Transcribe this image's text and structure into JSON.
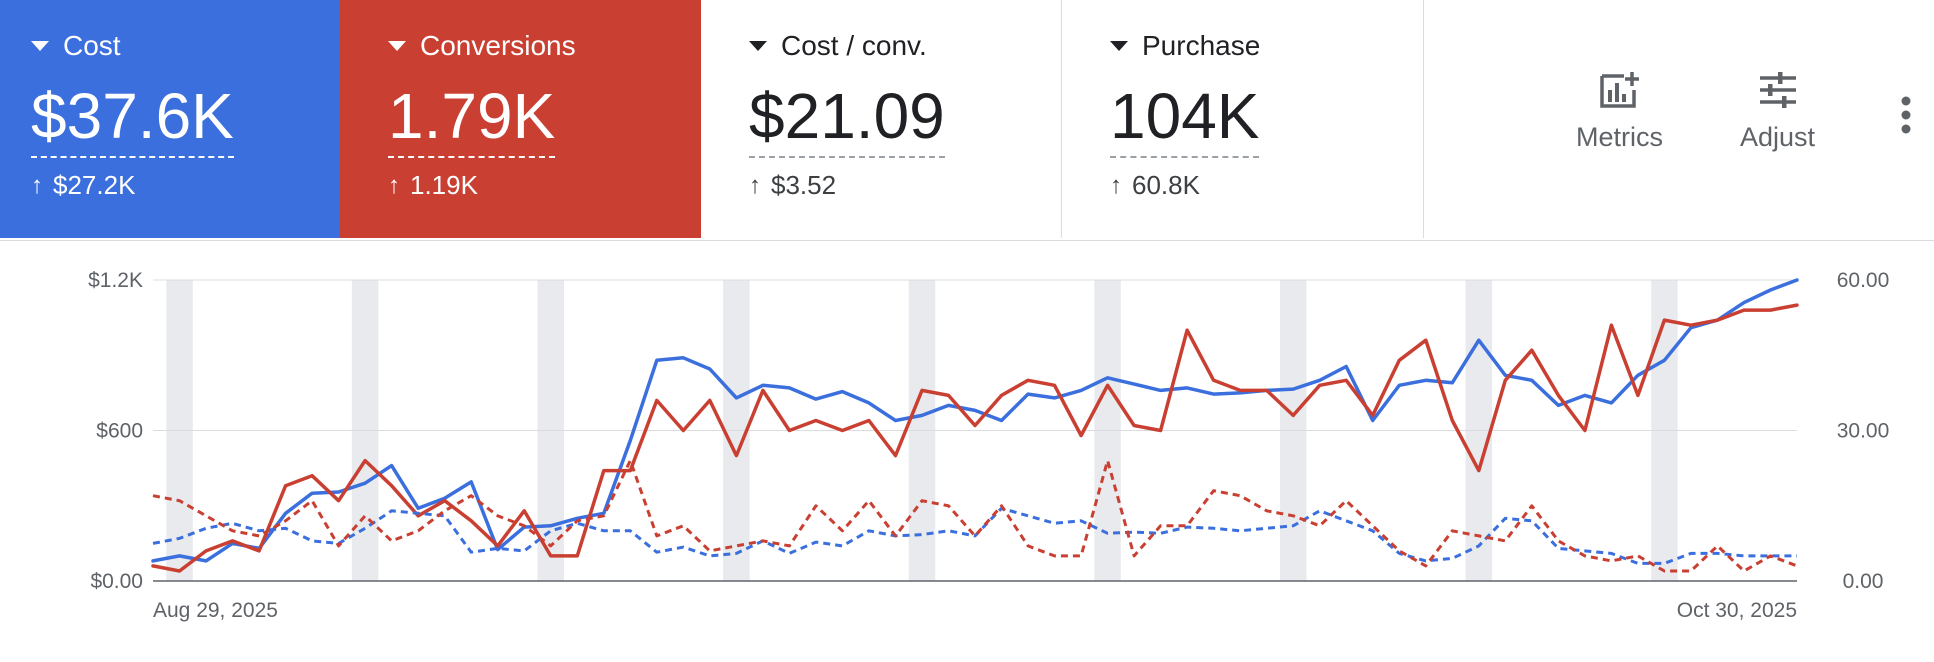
{
  "scorecards": [
    {
      "label": "Cost",
      "value": "$37.6K",
      "delta": "$27.2K",
      "bg": "#3b6fde",
      "text_color": "#ffffff"
    },
    {
      "label": "Conversions",
      "value": "1.79K",
      "delta": "1.19K",
      "bg": "#c94032",
      "text_color": "#ffffff"
    },
    {
      "label": "Cost / conv.",
      "value": "$21.09",
      "delta": "$3.52",
      "bg": "#ffffff",
      "text_color": "#202124"
    },
    {
      "label": "Purchase",
      "value": "104K",
      "delta": "60.8K",
      "bg": "#ffffff",
      "text_color": "#202124"
    }
  ],
  "toolbar": {
    "metrics_label": "Metrics",
    "adjust_label": "Adjust",
    "metrics_icon": "add-chart-icon",
    "adjust_icon": "tune-icon",
    "more_icon": "more-vert-icon"
  },
  "chart_data": {
    "type": "line",
    "x_start_label": "Aug 29, 2025",
    "x_end_label": "Oct 30, 2025",
    "x_count": 63,
    "y_left": {
      "ticks": [
        "$0.00",
        "$600",
        "$1.2K"
      ],
      "ylim": [
        0,
        1200
      ]
    },
    "y_right": {
      "ticks": [
        "0.00",
        "30.00",
        "60.00"
      ],
      "ylim": [
        0,
        60
      ]
    },
    "grid": true,
    "weekend_band_starts": [
      1,
      8,
      15,
      22,
      29,
      36,
      43,
      50,
      57
    ],
    "colors": {
      "cost": "#3b6fde",
      "conversions": "#c94032",
      "band": "#e8eaed",
      "grid": "#dadce0"
    },
    "series": [
      {
        "color": "#3b6fde",
        "axis": "left",
        "dashed": false,
        "values": [
          80,
          100,
          80,
          150,
          130,
          270,
          350,
          355,
          390,
          460,
          290,
          330,
          395,
          125,
          215,
          220,
          250,
          270,
          560,
          880,
          890,
          845,
          730,
          780,
          770,
          725,
          755,
          710,
          640,
          660,
          700,
          680,
          640,
          745,
          730,
          760,
          810,
          785,
          760,
          770,
          745,
          750,
          760,
          765,
          800,
          855,
          640,
          780,
          800,
          790,
          960,
          820,
          800,
          700,
          740,
          710,
          820,
          880,
          1010,
          1040,
          1110,
          1160,
          1200
        ]
      },
      {
        "color": "#c94032",
        "axis": "right",
        "dashed": false,
        "values": [
          3,
          2,
          6,
          8,
          6,
          19,
          21,
          16,
          24,
          19,
          13,
          16,
          12,
          7,
          14,
          5,
          5,
          22,
          22,
          36,
          30,
          36,
          25,
          38,
          30,
          32,
          30,
          32,
          25,
          38,
          37,
          31,
          37,
          40,
          39,
          29,
          39,
          31,
          30,
          50,
          40,
          38,
          38,
          33,
          39,
          40,
          33,
          44,
          48,
          32,
          22,
          40,
          46,
          37,
          30,
          51,
          37,
          52,
          51,
          52,
          54,
          54,
          55
        ]
      },
      {
        "color": "#3b6fde",
        "axis": "left",
        "dashed": true,
        "values": [
          150,
          170,
          210,
          230,
          200,
          210,
          160,
          150,
          210,
          280,
          270,
          260,
          115,
          130,
          120,
          200,
          230,
          200,
          200,
          115,
          135,
          100,
          110,
          160,
          110,
          155,
          140,
          200,
          180,
          185,
          200,
          180,
          290,
          260,
          230,
          240,
          190,
          195,
          190,
          215,
          210,
          200,
          210,
          220,
          280,
          240,
          200,
          110,
          80,
          90,
          140,
          250,
          240,
          130,
          120,
          110,
          70,
          70,
          110,
          110,
          100,
          100,
          100
        ]
      },
      {
        "color": "#c94032",
        "axis": "right",
        "dashed": true,
        "values": [
          17,
          16,
          13,
          10,
          9,
          12,
          16,
          7,
          13,
          8,
          10,
          14,
          17,
          13,
          11,
          7,
          12,
          13,
          24,
          9,
          11,
          6,
          7,
          8,
          7,
          15,
          10,
          16,
          9,
          16,
          15,
          9,
          15,
          7,
          5,
          5,
          24,
          5,
          11,
          11,
          18,
          17,
          14,
          13,
          11,
          16,
          11,
          6,
          3,
          10,
          9,
          8,
          15,
          8,
          5,
          4,
          5,
          2,
          2,
          7,
          2,
          5,
          3
        ]
      }
    ]
  }
}
